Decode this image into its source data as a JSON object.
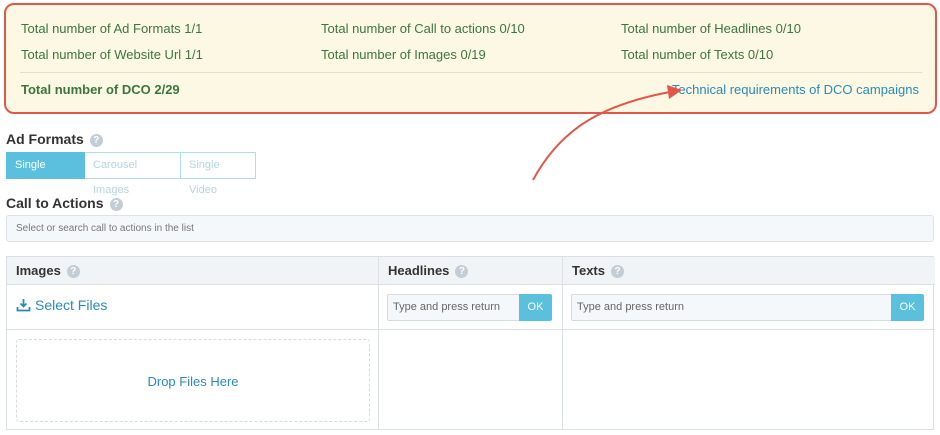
{
  "summary": {
    "ad_formats": "Total number of Ad Formats 1/1",
    "call_to_actions": "Total number of Call to actions 0/10",
    "headlines": "Total number of Headlines 0/10",
    "website_url": "Total number of Website Url 1/1",
    "images": "Total number of Images 0/19",
    "texts": "Total number of Texts 0/10",
    "total_dco": "Total number of DCO 2/29",
    "requirements_link": "Technical requirements of DCO campaigns"
  },
  "ad_formats": {
    "title": "Ad Formats",
    "help": "?",
    "options": [
      "Single Image",
      "Carousel Images",
      "Single Video"
    ],
    "selected": "Single Image"
  },
  "call_to_actions": {
    "title": "Call to Actions",
    "help": "?",
    "placeholder": "Select or search call to actions in the list"
  },
  "images": {
    "title": "Images",
    "help": "?",
    "select_files": "Select Files",
    "drop_files": "Drop Files Here"
  },
  "headlines": {
    "title": "Headlines",
    "help": "?",
    "placeholder": "Type and press return",
    "ok": "OK"
  },
  "texts": {
    "title": "Texts",
    "help": "?",
    "placeholder": "Type and press return",
    "ok": "OK"
  },
  "colors": {
    "highlight_border": "#e2574c",
    "summary_bg": "#fcf8e3",
    "summary_text": "#3c763d",
    "accent": "#5bc0de",
    "link": "#2a8ab8"
  }
}
